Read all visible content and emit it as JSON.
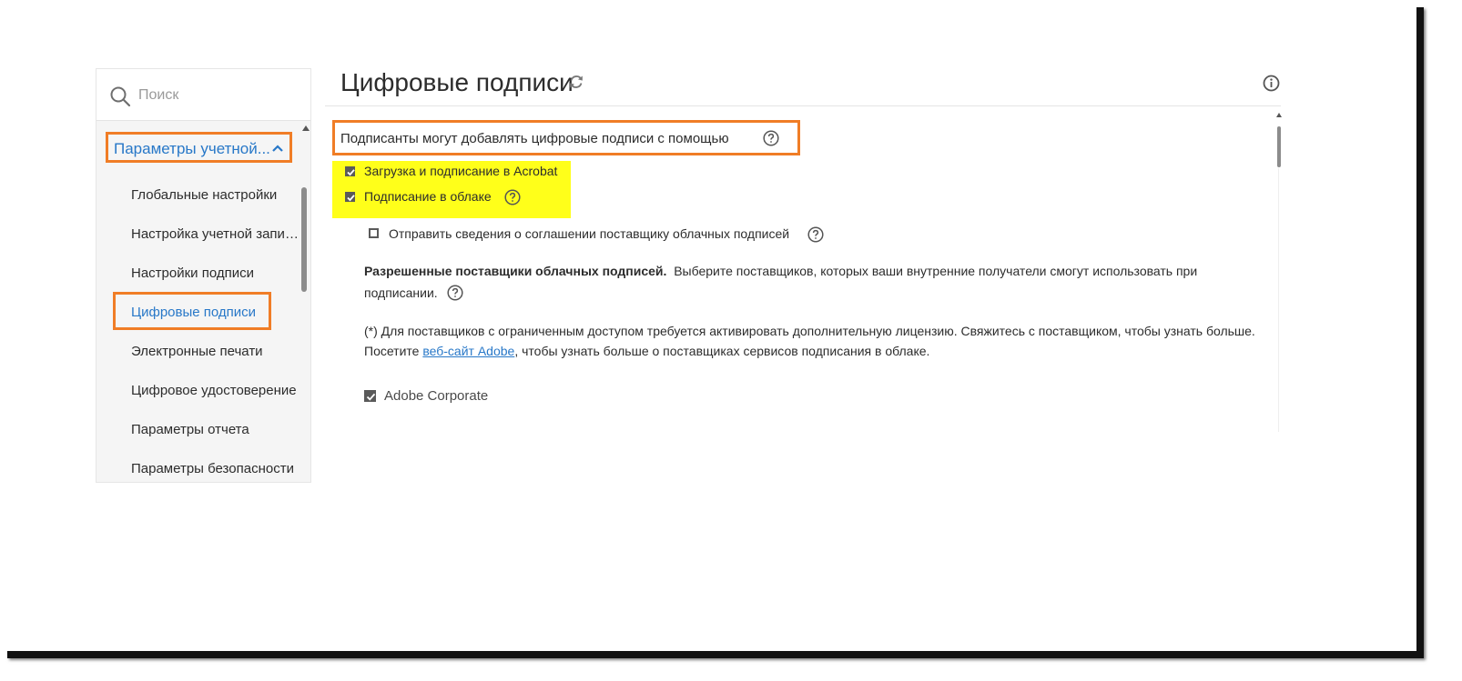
{
  "sidebar": {
    "search_placeholder": "Поиск",
    "group_label": "Параметры учетной...",
    "items": [
      {
        "label": "Глобальные настройки"
      },
      {
        "label": "Настройка учетной записи"
      },
      {
        "label": "Настройки подписи"
      },
      {
        "label": "Цифровые подписи"
      },
      {
        "label": "Электронные печати"
      },
      {
        "label": "Цифровое удостоверение"
      },
      {
        "label": "Параметры отчета"
      },
      {
        "label": "Параметры безопасности"
      }
    ],
    "active_item": "Цифровые подписи"
  },
  "main": {
    "title": "Цифровые подписи",
    "section_heading": "Подписанты могут добавлять цифровые подписи с помощью",
    "options": [
      {
        "label": "Загрузка и подписание в Acrobat",
        "checked": true
      },
      {
        "label": "Подписание в облаке",
        "checked": true
      },
      {
        "label": "Отправить сведения о соглашении поставщику облачных подписей",
        "checked": false
      }
    ],
    "providers_bold": "Разрешенные поставщики облачных подписей.",
    "providers_text_line1": "Выберите поставщиков, которых ваши внутренние получатели смогут использовать при",
    "providers_text_line2": "подписании.",
    "note_line1": "(*) Для поставщиков с ограниченным доступом требуется активировать дополнительную лицензию. Свяжитесь с поставщиком, чтобы узнать больше.",
    "note_line2_before": "Посетите ",
    "note_link": "веб-сайт Adobe",
    "note_line2_after": ", чтобы узнать больше о поставщиках сервисов подписания в облаке.",
    "provider_option": {
      "label": "Adobe Corporate",
      "checked": true
    }
  },
  "colors": {
    "accent_blue": "#2878c8",
    "callout_orange": "#f07d26",
    "highlight_yellow": "#ffff1a"
  },
  "icons": [
    "search-icon",
    "chevron-up-icon",
    "refresh-icon",
    "info-icon",
    "help-icon",
    "checkmark-icon"
  ]
}
